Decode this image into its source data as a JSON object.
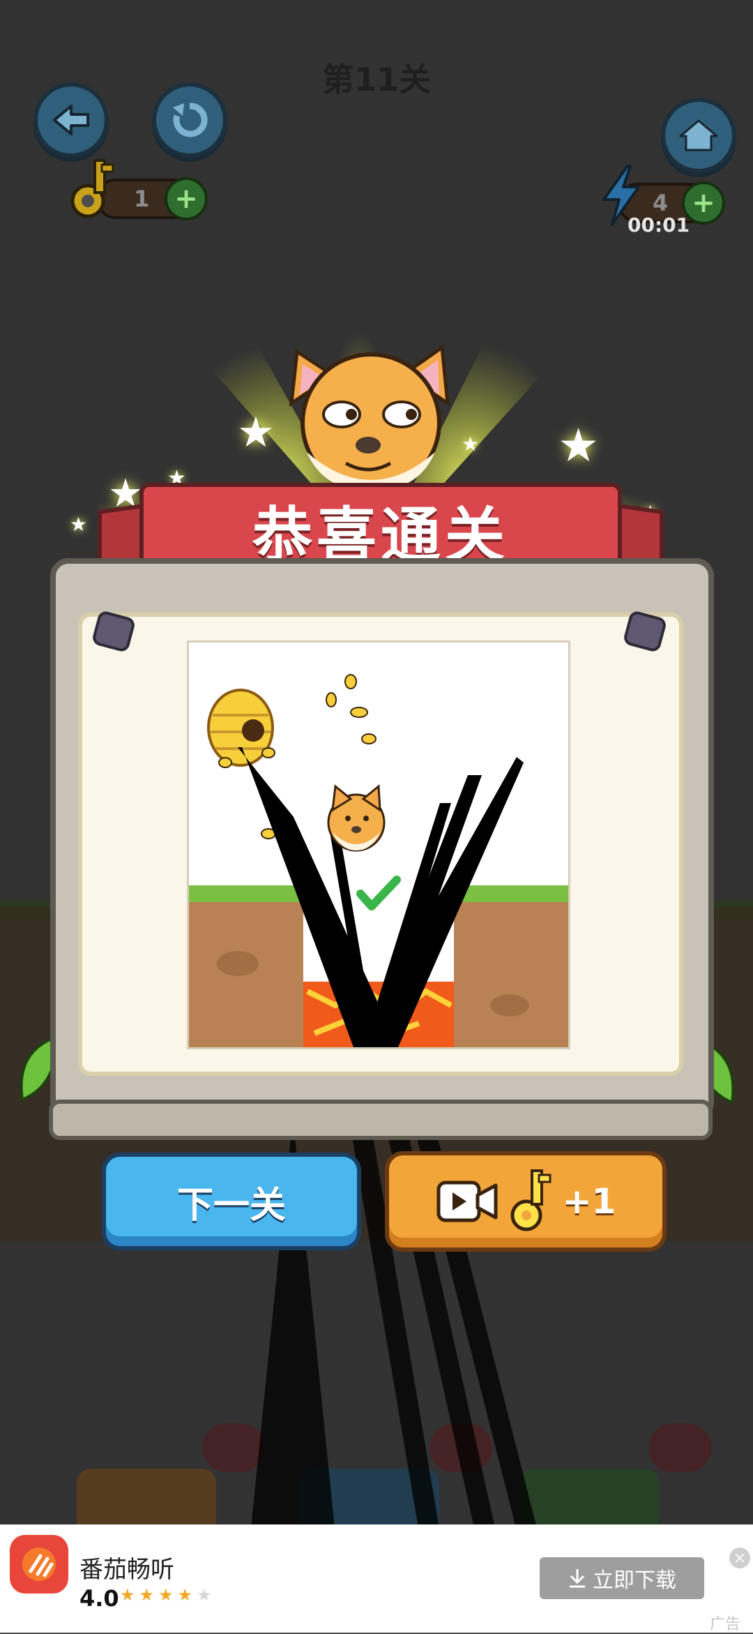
{
  "hud": {
    "level_title": "第11关",
    "keys_count": "1",
    "energy_count": "4",
    "timer": "00:01",
    "icons": [
      "back-arrow-icon",
      "restart-icon",
      "home-icon",
      "key-icon",
      "lightning-icon",
      "plus-icon"
    ]
  },
  "result": {
    "banner": "恭喜通关",
    "mascot": "shiba-dog-icon"
  },
  "scene": {
    "elements": [
      "beehive",
      "bees",
      "shiba-dog",
      "grass",
      "dirt",
      "lava",
      "drawn-black-lines",
      "check-mark"
    ]
  },
  "buttons": {
    "next_level": "下一关",
    "reward_key": "+1",
    "reward_icons": [
      "video-camera-icon",
      "key-icon"
    ]
  },
  "ad": {
    "app_name": "番茄畅听",
    "rating": "4.0",
    "stars": "★★★★",
    "empty_star": "★",
    "download": "立即下载",
    "tag": "广告",
    "close": "×"
  },
  "colors": {
    "banner": "#d9474c",
    "next_button": "#4ab6ee",
    "reward_button": "#f2a63a",
    "panel": "#c9c3b7"
  }
}
